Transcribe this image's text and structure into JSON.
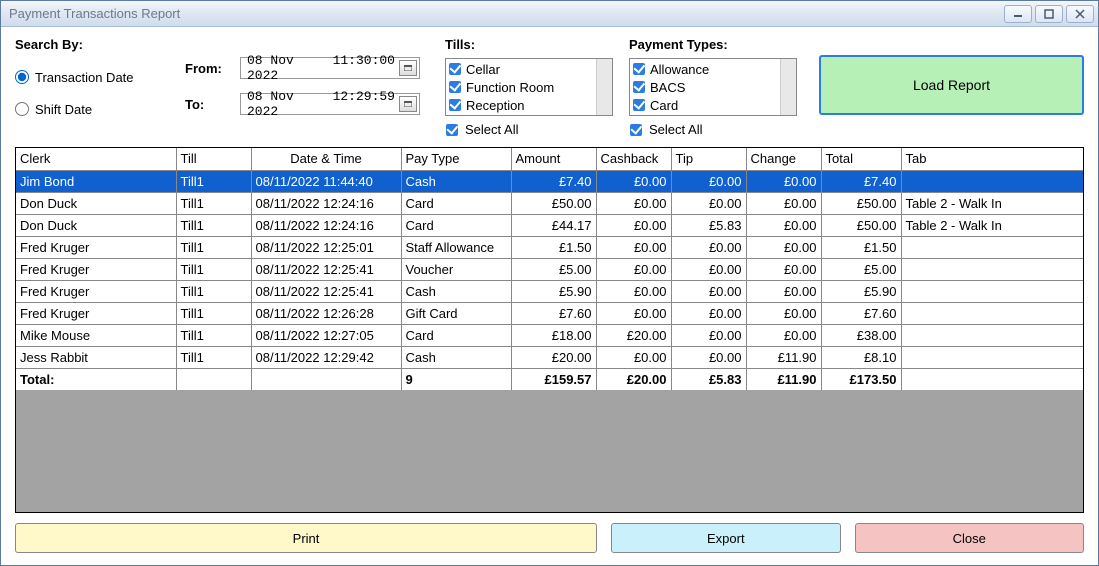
{
  "window": {
    "title": "Payment Transactions Report"
  },
  "search": {
    "label": "Search By:",
    "transaction_date": "Transaction Date",
    "shift_date": "Shift Date"
  },
  "dates": {
    "from_label": "From:",
    "to_label": "To:",
    "from_date": "08 Nov 2022",
    "from_time": "11:30:00",
    "to_date": "08 Nov 2022",
    "to_time": "12:29:59"
  },
  "tills": {
    "label": "Tills:",
    "items": [
      "Cellar",
      "Function Room",
      "Reception"
    ],
    "select_all": "Select All"
  },
  "ptypes": {
    "label": "Payment Types:",
    "items": [
      "Allowance",
      "BACS",
      "Card"
    ],
    "select_all": "Select All"
  },
  "load_label": "Load Report",
  "grid": {
    "columns": [
      "Clerk",
      "Till",
      "Date & Time",
      "Pay Type",
      "Amount",
      "Cashback",
      "Tip",
      "Change",
      "Total",
      "Tab"
    ],
    "rows": [
      {
        "clerk": "Jim Bond",
        "till": "Till1",
        "dt": "08/11/2022 11:44:40",
        "ptype": "Cash",
        "amount": "£7.40",
        "cashback": "£0.00",
        "tip": "£0.00",
        "change": "£0.00",
        "total": "£7.40",
        "tab": ""
      },
      {
        "clerk": "Don Duck",
        "till": "Till1",
        "dt": "08/11/2022 12:24:16",
        "ptype": "Card",
        "amount": "£50.00",
        "cashback": "£0.00",
        "tip": "£0.00",
        "change": "£0.00",
        "total": "£50.00",
        "tab": "Table 2 - Walk In"
      },
      {
        "clerk": "Don Duck",
        "till": "Till1",
        "dt": "08/11/2022 12:24:16",
        "ptype": "Card",
        "amount": "£44.17",
        "cashback": "£0.00",
        "tip": "£5.83",
        "change": "£0.00",
        "total": "£50.00",
        "tab": "Table 2 - Walk In"
      },
      {
        "clerk": "Fred Kruger",
        "till": "Till1",
        "dt": "08/11/2022 12:25:01",
        "ptype": "Staff Allowance",
        "amount": "£1.50",
        "cashback": "£0.00",
        "tip": "£0.00",
        "change": "£0.00",
        "total": "£1.50",
        "tab": ""
      },
      {
        "clerk": "Fred Kruger",
        "till": "Till1",
        "dt": "08/11/2022 12:25:41",
        "ptype": "Voucher",
        "amount": "£5.00",
        "cashback": "£0.00",
        "tip": "£0.00",
        "change": "£0.00",
        "total": "£5.00",
        "tab": ""
      },
      {
        "clerk": "Fred Kruger",
        "till": "Till1",
        "dt": "08/11/2022 12:25:41",
        "ptype": "Cash",
        "amount": "£5.90",
        "cashback": "£0.00",
        "tip": "£0.00",
        "change": "£0.00",
        "total": "£5.90",
        "tab": ""
      },
      {
        "clerk": "Fred Kruger",
        "till": "Till1",
        "dt": "08/11/2022 12:26:28",
        "ptype": "Gift Card",
        "amount": "£7.60",
        "cashback": "£0.00",
        "tip": "£0.00",
        "change": "£0.00",
        "total": "£7.60",
        "tab": ""
      },
      {
        "clerk": "Mike Mouse",
        "till": "Till1",
        "dt": "08/11/2022 12:27:05",
        "ptype": "Card",
        "amount": "£18.00",
        "cashback": "£20.00",
        "tip": "£0.00",
        "change": "£0.00",
        "total": "£38.00",
        "tab": ""
      },
      {
        "clerk": "Jess Rabbit",
        "till": "Till1",
        "dt": "08/11/2022 12:29:42",
        "ptype": "Cash",
        "amount": "£20.00",
        "cashback": "£0.00",
        "tip": "£0.00",
        "change": "£11.90",
        "total": "£8.10",
        "tab": ""
      }
    ],
    "total_row": {
      "label": "Total:",
      "count": "9",
      "amount": "£159.57",
      "cashback": "£20.00",
      "tip": "£5.83",
      "change": "£11.90",
      "total": "£173.50"
    }
  },
  "footer": {
    "print": "Print",
    "export": "Export",
    "close": "Close"
  }
}
